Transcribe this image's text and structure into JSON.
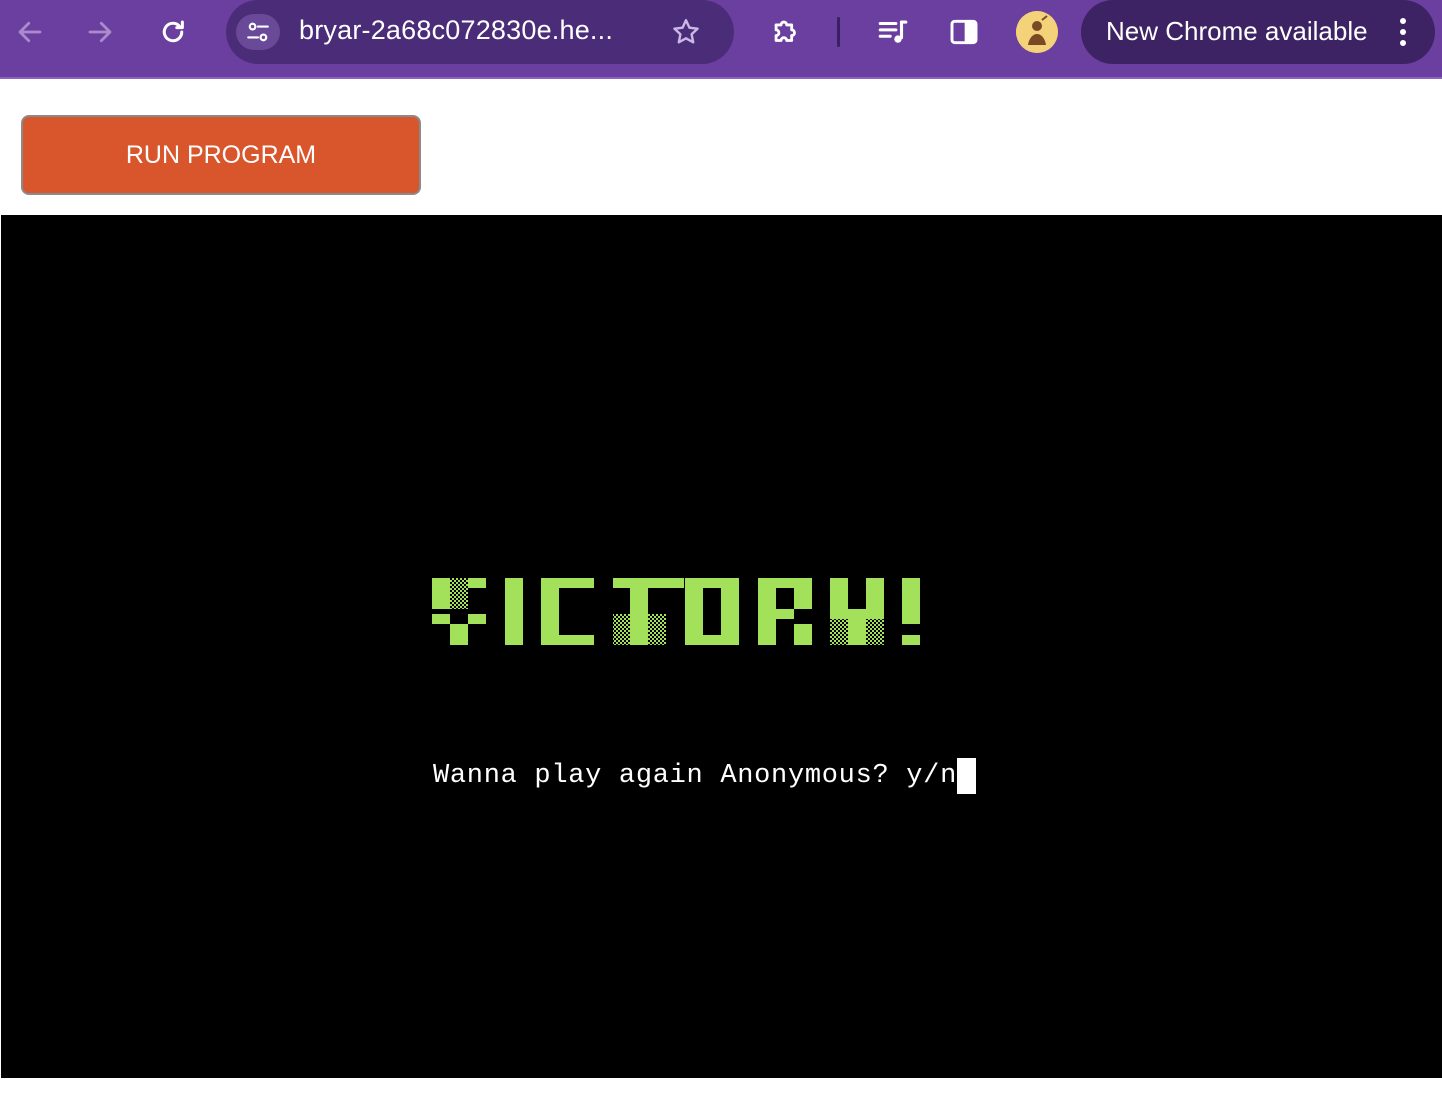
{
  "browser": {
    "url": "bryar-2a68c072830e.he...",
    "update_pill": "New Chrome available",
    "icons": {
      "back": "arrow-left-icon",
      "forward": "arrow-right-icon",
      "reload": "reload-icon",
      "site_info": "tune-icon",
      "bookmark": "star-icon",
      "extensions": "puzzle-icon",
      "media": "queue-music-icon",
      "side_panel": "side-panel-icon",
      "profile": "avatar",
      "menu": "kebab-icon"
    },
    "colors": {
      "toolbar": "#6b3fa0",
      "omnibox": "#4a2c78",
      "update_pill": "#3d2363"
    }
  },
  "page": {
    "run_button": "RUN PROGRAM",
    "run_button_color": "#d9552b"
  },
  "terminal": {
    "banner_art_text": "VICTORY!",
    "banner_color": "#a3e15a",
    "prompt": "Wanna play again Anonymous? y/n",
    "background": "#000000"
  }
}
